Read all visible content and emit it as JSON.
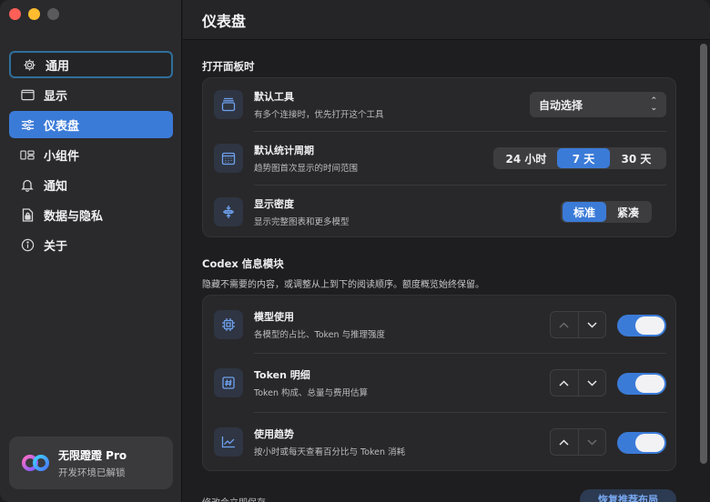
{
  "sidebar": {
    "items": [
      {
        "label": "通用",
        "icon": "gear-icon",
        "state": "focused"
      },
      {
        "label": "显示",
        "icon": "display-icon",
        "state": ""
      },
      {
        "label": "仪表盘",
        "icon": "sliders-icon",
        "state": "active"
      },
      {
        "label": "小组件",
        "icon": "widgets-icon",
        "state": ""
      },
      {
        "label": "通知",
        "icon": "bell-icon",
        "state": ""
      },
      {
        "label": "数据与隐私",
        "icon": "document-lock-icon",
        "state": ""
      },
      {
        "label": "关于",
        "icon": "info-icon",
        "state": ""
      }
    ],
    "promo": {
      "title": "无限蹬蹬 Pro",
      "subtitle": "开发环境已解锁"
    }
  },
  "header": {
    "title": "仪表盘"
  },
  "section_open": {
    "heading": "打开面板时",
    "default_tool": {
      "title": "默认工具",
      "subtitle": "有多个连接时，优先打开这个工具",
      "value": "自动选择"
    },
    "default_period": {
      "title": "默认统计周期",
      "subtitle": "趋势图首次显示的时间范围",
      "options": [
        "24 小时",
        "7 天",
        "30 天"
      ],
      "selected": "7 天"
    },
    "density": {
      "title": "显示密度",
      "subtitle": "显示完整图表和更多模型",
      "options": [
        "标准",
        "紧凑"
      ],
      "selected": "标准"
    }
  },
  "section_codex": {
    "heading": "Codex 信息模块",
    "description": "隐藏不需要的内容，或调整从上到下的阅读顺序。额度概览始终保留。",
    "modules": [
      {
        "title": "模型使用",
        "subtitle": "各模型的占比、Token 与推理强度",
        "icon": "chip-icon",
        "enabled": true
      },
      {
        "title": "Token 明细",
        "subtitle": "Token 构成、总量与费用估算",
        "icon": "hash-icon",
        "enabled": true
      },
      {
        "title": "使用趋势",
        "subtitle": "按小时或每天查看百分比与 Token 消耗",
        "icon": "trend-chart-icon",
        "enabled": true
      }
    ]
  },
  "footer": {
    "text": "修改会立即保存",
    "reset_label": "恢复推荐布局"
  },
  "colors": {
    "accent": "#3b7bd8",
    "sidebar_bg": "#2a2a2c",
    "main_bg": "#1e1e20"
  }
}
